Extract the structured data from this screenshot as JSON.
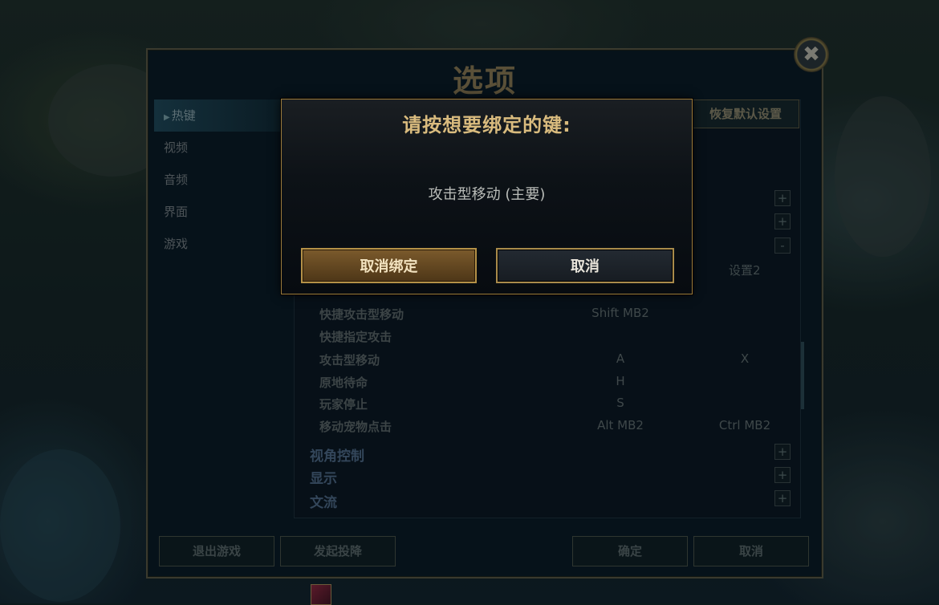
{
  "window": {
    "title": "选项",
    "close_glyph": "✖"
  },
  "sidebar": {
    "items": [
      {
        "label": "热键",
        "active": true
      },
      {
        "label": "视频"
      },
      {
        "label": "音频"
      },
      {
        "label": "界面"
      },
      {
        "label": "游戏"
      }
    ]
  },
  "content": {
    "reset_label": "恢复默认设置",
    "column2_header": "设置2",
    "plus_glyph": "+",
    "minus_glyph": "-",
    "rows": [
      {
        "action": "快捷攻击型移动",
        "key1": "Shift MB2",
        "key2": ""
      },
      {
        "action": "快捷指定攻击",
        "key1": "",
        "key2": ""
      },
      {
        "action": "攻击型移动",
        "key1": "A",
        "key2": "X"
      },
      {
        "action": "原地待命",
        "key1": "H",
        "key2": ""
      },
      {
        "action": "玩家停止",
        "key1": "S",
        "key2": ""
      },
      {
        "action": "移动宠物点击",
        "key1": "Alt MB2",
        "key2": "Ctrl MB2"
      }
    ],
    "sections": [
      "视角控制",
      "显示",
      "文流"
    ]
  },
  "footer": {
    "quit_label": "退出游戏",
    "surrender_label": "发起投降",
    "ok_label": "确定",
    "cancel_label": "取消"
  },
  "modal": {
    "title": "请按想要绑定的键:",
    "action_name": "攻击型移动 (主要)",
    "unbind_label": "取消绑定",
    "cancel_label": "取消"
  },
  "colors": {
    "gold_text": "#d9bb7e",
    "gold_border": "#9b7b3c",
    "unbind_button": "#6b4e24"
  }
}
